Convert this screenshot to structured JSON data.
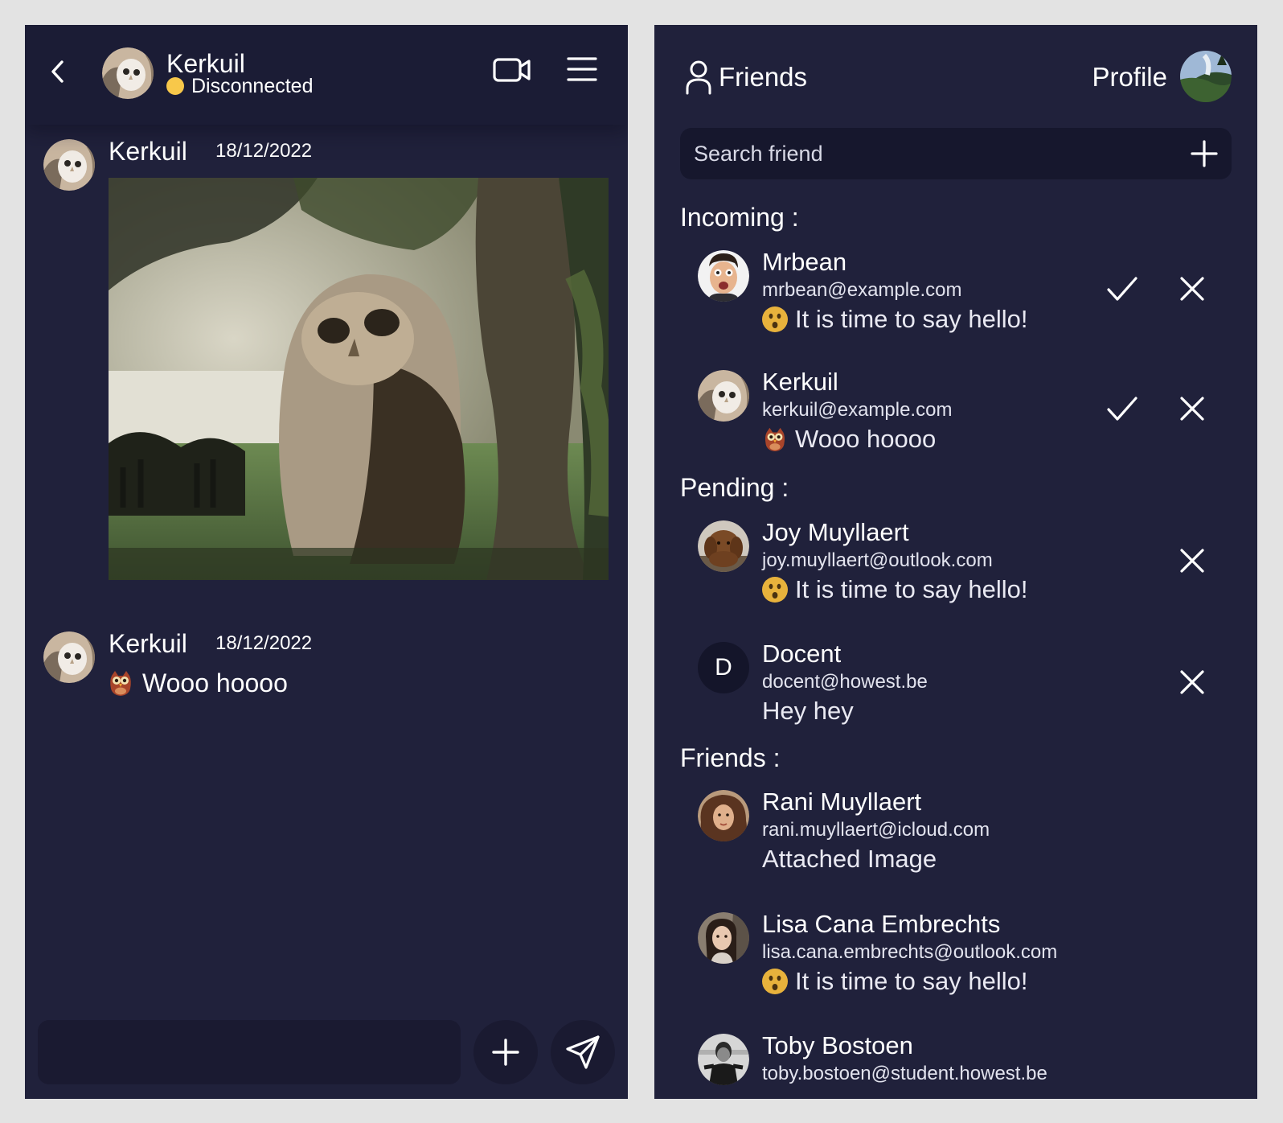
{
  "chat": {
    "contact_name": "Kerkuil",
    "status": "Disconnected",
    "status_color": "#f8c84a",
    "messages": [
      {
        "author": "Kerkuil",
        "date": "18/12/2022",
        "kind": "image"
      },
      {
        "author": "Kerkuil",
        "date": "18/12/2022",
        "kind": "text",
        "emoji": "owl-icon",
        "text": "Wooo hoooo"
      }
    ],
    "composer": {
      "value": "",
      "placeholder": ""
    }
  },
  "friends_panel": {
    "title": "Friends",
    "profile_label": "Profile",
    "search": {
      "placeholder": "Search friend",
      "value": ""
    },
    "sections": {
      "incoming": "Incoming :",
      "pending": "Pending :",
      "friends": "Friends :"
    },
    "incoming": [
      {
        "name": "Mrbean",
        "email": "mrbean@example.com",
        "emoji": "hushed-face-icon",
        "message": "It is time to say hello!"
      },
      {
        "name": "Kerkuil",
        "email": "kerkuil@example.com",
        "emoji": "owl-icon",
        "message": "Wooo hoooo"
      }
    ],
    "pending": [
      {
        "name": "Joy Muyllaert",
        "email": "joy.muyllaert@outlook.com",
        "emoji": "hushed-face-icon",
        "message": "It is time to say hello!"
      },
      {
        "name": "Docent",
        "email": "docent@howest.be",
        "message": "Hey hey",
        "avatar_letter": "D"
      }
    ],
    "friends": [
      {
        "name": "Rani Muyllaert",
        "email": "rani.muyllaert@icloud.com",
        "message": "Attached Image"
      },
      {
        "name": "Lisa Cana Embrechts",
        "email": "lisa.cana.embrechts@outlook.com",
        "emoji": "hushed-face-icon",
        "message": "It is time to say hello!"
      },
      {
        "name": "Toby Bostoen",
        "email": "toby.bostoen@student.howest.be"
      }
    ]
  },
  "colors": {
    "panel_bg": "#20213b",
    "header_bg": "#1b1c35",
    "input_bg": "#1a1a31",
    "page_bg": "#e3e3e3",
    "emoji_yellow": "#e8b23c"
  }
}
